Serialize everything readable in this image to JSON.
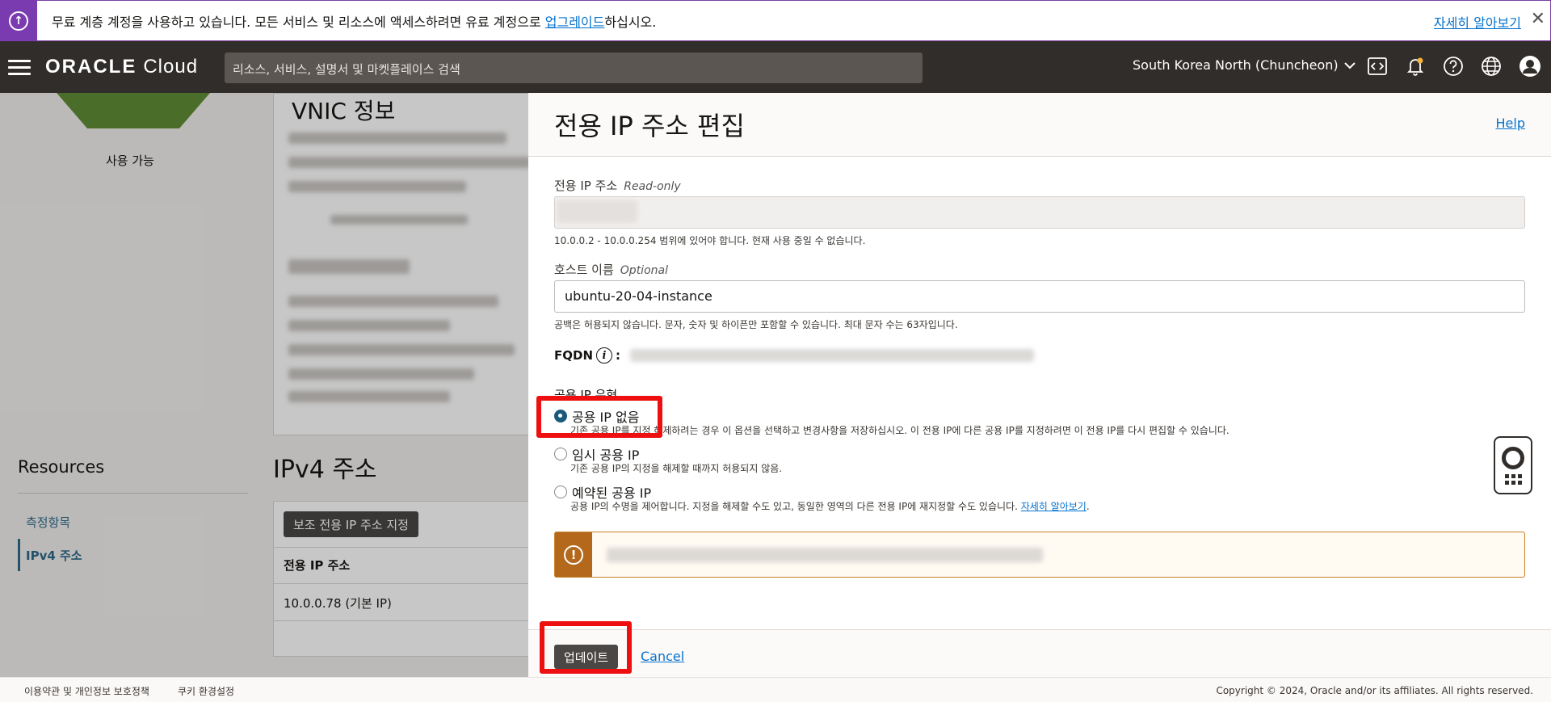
{
  "banner": {
    "text_before": "무료 계층 계정을 사용하고 있습니다. 모든 서비스 및 리소스에 액세스하려면 유료 계정으로 ",
    "upgrade_link": "업그레이드",
    "text_after": "하십시오.",
    "more_link": "자세히 알아보기",
    "close": "✕"
  },
  "header": {
    "logo_oracle": "ORACLE",
    "logo_cloud": "Cloud",
    "search_placeholder": "리소스, 서비스, 설명서 및 마켓플레이스 검색",
    "region": "South Korea North (Chuncheon)"
  },
  "background": {
    "status": "사용 가능",
    "vnic_title": "VNIC 정보",
    "resources_title": "Resources",
    "resources_items": [
      "측정항목",
      "IPv4 주소"
    ],
    "ipv4_title": "IPv4 주소",
    "assign_button": "보조 전용 IP 주소 지정",
    "table_header": "전용 IP 주소",
    "table_row": "10.0.0.78 (기본 IP)"
  },
  "panel": {
    "title": "전용 IP 주소 편집",
    "help": "Help",
    "private_ip_label": "전용 IP 주소",
    "private_ip_tag": "Read-only",
    "private_ip_hint": "10.0.0.2 - 10.0.0.254 범위에 있어야 합니다. 현재 사용 중일 수 없습니다.",
    "hostname_label": "호스트 이름",
    "hostname_tag": "Optional",
    "hostname_value": "ubuntu-20-04-instance",
    "hostname_hint": "공백은 허용되지 않습니다. 문자, 숫자 및 하이픈만 포함할 수 있습니다. 최대 문자 수는 63자입니다.",
    "fqdn_label": "FQDN",
    "public_ip_type_label": "공용 IP 유형",
    "options": [
      {
        "label": "공용 IP 없음",
        "desc": "기존 공용 IP를 지정 해제하려는 경우 이 옵션을 선택하고 변경사항을 저장하십시오. 이 전용 IP에 다른 공용 IP를 지정하려면 이 전용 IP를 다시 편집할 수 있습니다."
      },
      {
        "label": "임시 공용 IP",
        "desc": "기존 공용 IP의 지정을 해제할 때까지 허용되지 않음."
      },
      {
        "label": "예약된 공용 IP",
        "desc": "공용 IP의 수명을 제어합니다. 지정을 해제할 수도 있고, 동일한 영역의 다른 전용 IP에 재지정할 수도 있습니다. ",
        "link": "자세히 알아보기",
        "desc_end": "."
      }
    ],
    "selected_option": 0,
    "update_button": "업데이트",
    "cancel": "Cancel"
  },
  "footer": {
    "terms": "이용약관 및 개인정보 보호정책",
    "cookies": "쿠키 환경설정",
    "copyright": "Copyright © 2024, Oracle and/or its affiliates. All rights reserved."
  },
  "colors": {
    "banner_accent": "#7b3bb0",
    "header_bg": "#312d2a",
    "link": "#0572ce",
    "warning": "#b3681c",
    "highlight": "#ee1010"
  }
}
